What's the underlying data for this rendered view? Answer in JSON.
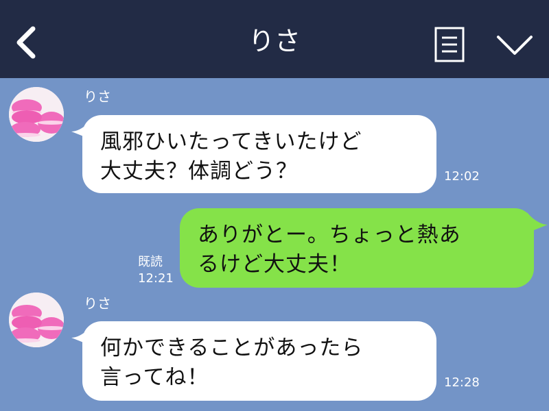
{
  "header": {
    "title": "りさ",
    "back_icon": "chevron-left-icon",
    "menu_icon": "notes-icon",
    "dropdown_icon": "chevron-down-icon",
    "background": "#222b45"
  },
  "chat": {
    "background": "#7394c7",
    "messages": [
      {
        "direction": "incoming",
        "sender": "りさ",
        "text": "風邪ひいたってきいたけど\n大丈夫？体調どう？",
        "time": "12:02"
      },
      {
        "direction": "outgoing",
        "text": "ありがとー。ちょっと熱あ\nるけど大丈夫！",
        "read_status": "既読",
        "time": "12:21"
      },
      {
        "direction": "incoming",
        "sender": "りさ",
        "text": "何かできることがあったら\n言ってね！",
        "time": "12:28"
      }
    ]
  },
  "colors": {
    "incoming_bubble": "#ffffff",
    "outgoing_bubble": "#85e249",
    "avatar_macaron": "#f06bbb"
  }
}
